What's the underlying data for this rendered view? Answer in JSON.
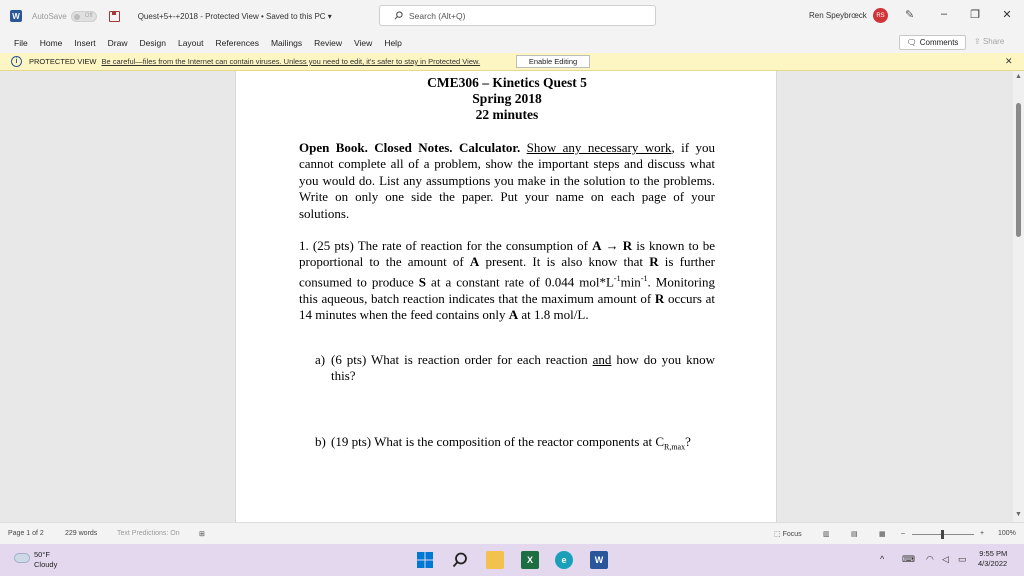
{
  "titlebar": {
    "autosave_label": "AutoSave",
    "autosave_state": "Off",
    "doc_title": "Quest+5+-+2018  -  Protected View • Saved to this PC  ▾",
    "search_placeholder": "Search (Alt+Q)",
    "user_name": "Ren Speybrœck",
    "user_initials": "RS"
  },
  "menu": [
    "File",
    "Home",
    "Insert",
    "Draw",
    "Design",
    "Layout",
    "References",
    "Mailings",
    "Review",
    "View",
    "Help"
  ],
  "comments_label": "Comments",
  "share_label": "Share",
  "protected_view": {
    "label": "PROTECTED VIEW",
    "message": "Be careful—files from the Internet can contain viruses. Unless you need to edit, it's safer to stay in Protected View.",
    "enable_button": "Enable Editing"
  },
  "document": {
    "title": "CME306 – Kinetics Quest 5",
    "term": "Spring 2018",
    "duration": "22 minutes",
    "intro_bold": "Open Book. Closed Notes. Calculator.",
    "intro_underlined": "Show any necessary work",
    "intro_rest": ", if you cannot complete all of a problem, show the important steps and discuss what you would do. List any assumptions you make in the solution to the problems. Write on only one side the paper. Put your name on each page of your solutions.",
    "q1_a": "1. (25 pts) The rate of reaction for the consumption of ",
    "q1_b": " is known to be proportional to the amount of ",
    "q1_c": " present. It is also know that ",
    "q1_d": " is further consumed to produce ",
    "q1_e": " at a constant rate of 0.044 mol*L",
    "q1_e_sup1": "-1",
    "q1_e2": "min",
    "q1_e_sup2": "-1",
    "q1_f": ". Monitoring this aqueous, batch reaction indicates that the maximum amount of ",
    "q1_g": " occurs at 14 minutes when the feed contains only ",
    "q1_h": " at 1.8 mol/L.",
    "species_A": "A",
    "arrow": " → ",
    "species_R": "R",
    "species_S": "S",
    "qa_num": "a)",
    "qa_pre": "(6 pts) What is reaction order for each reaction ",
    "qa_and": "and",
    "qa_post": " how do you know this?",
    "qb_num": "b)",
    "qb_text": "(19 pts) What is the composition of the reactor components at C",
    "qb_sub": "R,max",
    "qb_end": "?"
  },
  "status": {
    "page": "Page 1 of 2",
    "words": "229 words",
    "text_predictions": "Text Predictions: On",
    "focus": "Focus",
    "zoom": "100%"
  },
  "taskbar": {
    "temp": "50°F",
    "condition": "Cloudy",
    "time": "9:55 PM",
    "date": "4/3/2022"
  },
  "colors": {
    "word_blue": "#2b579a",
    "protected_bg": "#fdf6c3",
    "avatar": "#d13438"
  }
}
